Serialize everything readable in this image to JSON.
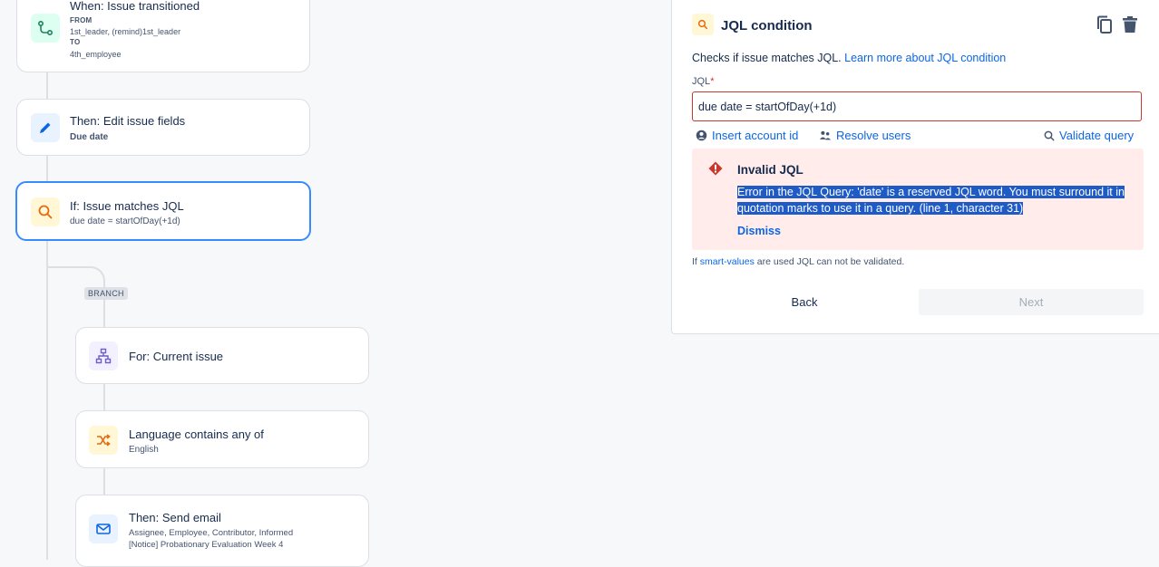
{
  "flow": {
    "trigger": {
      "title": "When: Issue transitioned",
      "from_label": "FROM",
      "from_value": "1st_leader, (remind)1st_leader",
      "to_label": "TO",
      "to_value": "4th_employee"
    },
    "edit": {
      "title": "Then: Edit issue fields",
      "sub": "Due date"
    },
    "jql": {
      "title": "If: Issue matches JQL",
      "sub": "due date = startOfDay(+1d)"
    },
    "branch_label": "BRANCH",
    "for": {
      "title": "For: Current issue"
    },
    "lang": {
      "title": "Language contains any of",
      "sub": "English"
    },
    "email": {
      "title": "Then: Send email",
      "sub1": "Assignee, Employee, Contributor, Informed",
      "sub2": "[Notice] Probationary Evaluation Week 4"
    }
  },
  "panel": {
    "title": "JQL condition",
    "desc": "Checks if issue matches JQL.",
    "learn_link": "Learn more about JQL condition",
    "field_label": "JQL",
    "required_mark": "*",
    "jql_value": "due date = startOfDay(+1d)",
    "insert_account": "Insert account id",
    "resolve_users": "Resolve users",
    "validate_query": "Validate query",
    "error_title": "Invalid JQL",
    "error_line1": "Error in the JQL Query: 'date' is a reserved JQL word. You must surround it in",
    "error_line2": "quotation marks to use it in a query. (line 1, character 31)",
    "dismiss": "Dismiss",
    "hint_prefix": "If",
    "hint_link": "smart-values",
    "hint_suffix": "are used JQL can not be validated.",
    "back": "Back",
    "next": "Next"
  },
  "colors": {
    "accent": "#0c66e4",
    "selected_border": "#388bff",
    "error_bg": "#ffeceb",
    "error_icon": "#c9372c"
  }
}
